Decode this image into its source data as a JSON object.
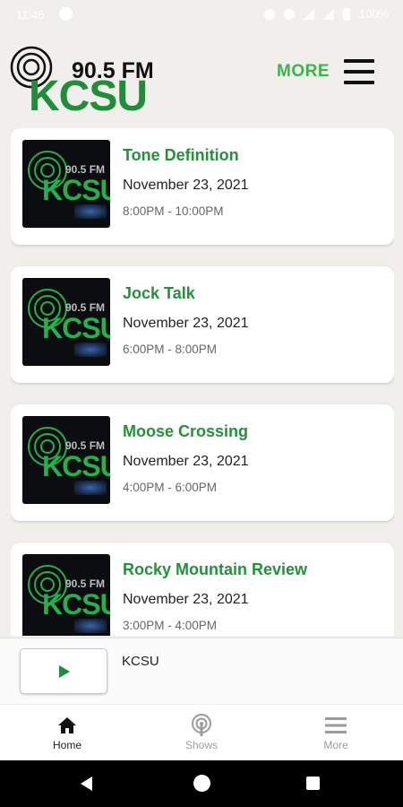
{
  "status_bar": {
    "time": "11:46",
    "battery": "100%"
  },
  "header": {
    "logo": {
      "frequency": "90.5 FM",
      "call_sign": "KCSU"
    },
    "more_label": "MORE"
  },
  "shows": [
    {
      "title": "Tone Definition",
      "date": "November 23, 2021",
      "time": "8:00PM - 10:00PM"
    },
    {
      "title": "Jock Talk",
      "date": "November 23, 2021",
      "time": "6:00PM - 8:00PM"
    },
    {
      "title": "Moose Crossing",
      "date": "November 23, 2021",
      "time": "4:00PM - 6:00PM"
    },
    {
      "title": "Rocky Mountain Review",
      "date": "November 23, 2021",
      "time": "3:00PM - 4:00PM"
    }
  ],
  "thumbnail": {
    "frequency": "90.5 FM",
    "call_sign": "KCSU"
  },
  "player": {
    "station": "KCSU"
  },
  "tabs": [
    {
      "label": "Home",
      "icon": "home-icon",
      "active": true
    },
    {
      "label": "Shows",
      "icon": "podcast-icon",
      "active": false
    },
    {
      "label": "More",
      "icon": "menu-icon",
      "active": false
    }
  ],
  "colors": {
    "brand_green": "#1f8d3a",
    "accent_green": "#3fb24f",
    "title_green": "#24913a",
    "background": "#f1efec"
  }
}
